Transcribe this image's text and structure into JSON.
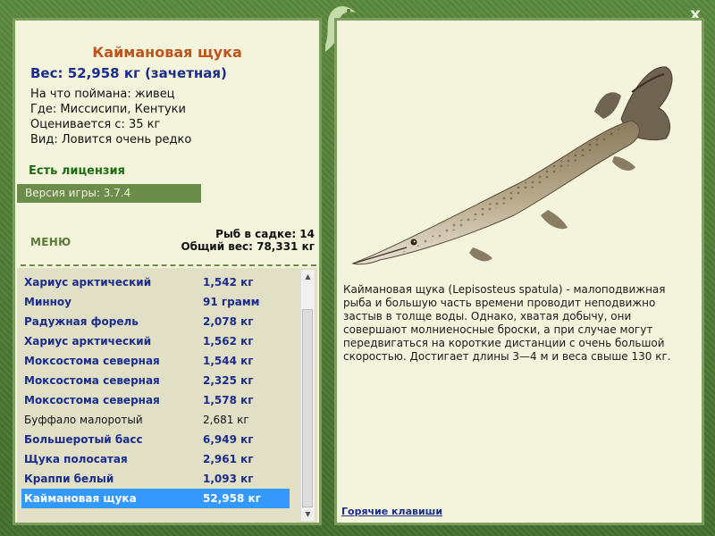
{
  "window": {
    "close_label": "x"
  },
  "fish": {
    "title": "Каймановая щука",
    "weight_line": "Вес: 52,958 кг (зачетная)",
    "caught_on": "На что поймана: живец",
    "location": "Где: Миссисипи, Кентуки",
    "rated_from": "Оценивается с: 35 кг",
    "species_note": "Вид: Ловится очень редко",
    "description": "Каймановая щука (Lepisosteus spatula) - малоподвижная рыба и большую часть времени проводит неподвижно застыв в толще воды. Однако, хватая добычу, они совершают молниеносные броски, а при случае могут передвигаться на короткие дистанции с очень большой скоростью. Достигает длины 3—4 м и веса свыше 130 кг."
  },
  "license": "Есть лицензия",
  "version": "Версия игры: 3.7.4",
  "menu_label": "МЕНЮ",
  "tank": {
    "fish_count": "Рыб в садке: 14",
    "total_weight": "Общий вес: 78,331 кг"
  },
  "catch_list": [
    {
      "name": "Хариус арктический",
      "weight": "1,542 кг",
      "style": "bold"
    },
    {
      "name": "Минноу",
      "weight": "91 грамм",
      "style": "bold"
    },
    {
      "name": "Радужная форель",
      "weight": "2,078 кг",
      "style": "bold"
    },
    {
      "name": "Хариус арктический",
      "weight": "1,562 кг",
      "style": "bold"
    },
    {
      "name": "Моксостома северная",
      "weight": "1,544 кг",
      "style": "bold"
    },
    {
      "name": "Моксостома северная",
      "weight": "2,325 кг",
      "style": "bold"
    },
    {
      "name": "Моксостома северная",
      "weight": "1,578 кг",
      "style": "bold"
    },
    {
      "name": "Буффало малоротый",
      "weight": "2,681 кг",
      "style": "plain"
    },
    {
      "name": "Большеротый басс",
      "weight": "6,949 кг",
      "style": "bold"
    },
    {
      "name": "Щука полосатая",
      "weight": "2,961 кг",
      "style": "bold"
    },
    {
      "name": "Краппи белый",
      "weight": "1,093 кг",
      "style": "bold"
    },
    {
      "name": "Каймановая щука",
      "weight": "52,958 кг",
      "style": "selected"
    }
  ],
  "hotkeys_label": "Горячие клавиши",
  "colors": {
    "frame": "#4f7a37",
    "panel": "#f4f3dc",
    "title": "#c0541c",
    "link": "#1a2d8c",
    "selection": "#3399ff"
  },
  "icons": {
    "close": "close-icon",
    "ornament": "fish-ornament-icon",
    "scroll_up": "scroll-up-arrow-icon",
    "scroll_down": "scroll-down-arrow-icon"
  }
}
